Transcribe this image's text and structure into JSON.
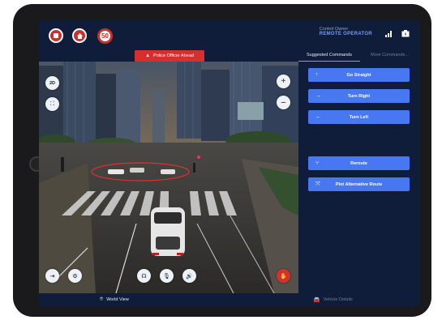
{
  "top": {
    "signs": [
      "no-entry-sign-icon",
      "home-sign-icon",
      "speed-limit-sign"
    ],
    "speed_limit": "50",
    "control_owner_label": "Control Owner",
    "control_owner_value": "REMOTE OPERATOR"
  },
  "alert": {
    "text": "Police Officer Ahead"
  },
  "tabs": [
    "Suggested Commands",
    "More Commands..."
  ],
  "map_controls": {
    "mode": "2D"
  },
  "commands": [
    {
      "label": "Go Straight",
      "icon": "↑"
    },
    {
      "label": "Turn Right",
      "icon": "→"
    },
    {
      "label": "Turn Left",
      "icon": "←"
    },
    {
      "label": "Reroute",
      "icon": "⑂"
    },
    {
      "label": "Plot Alternative Route",
      "icon": "⤧"
    }
  ],
  "bottom_nav": {
    "world_view": "World View",
    "vehicle_details": "Vehicle Details"
  },
  "colors": {
    "accent": "#4877f2",
    "alert": "#d5302e",
    "background": "#0f1c3a"
  }
}
